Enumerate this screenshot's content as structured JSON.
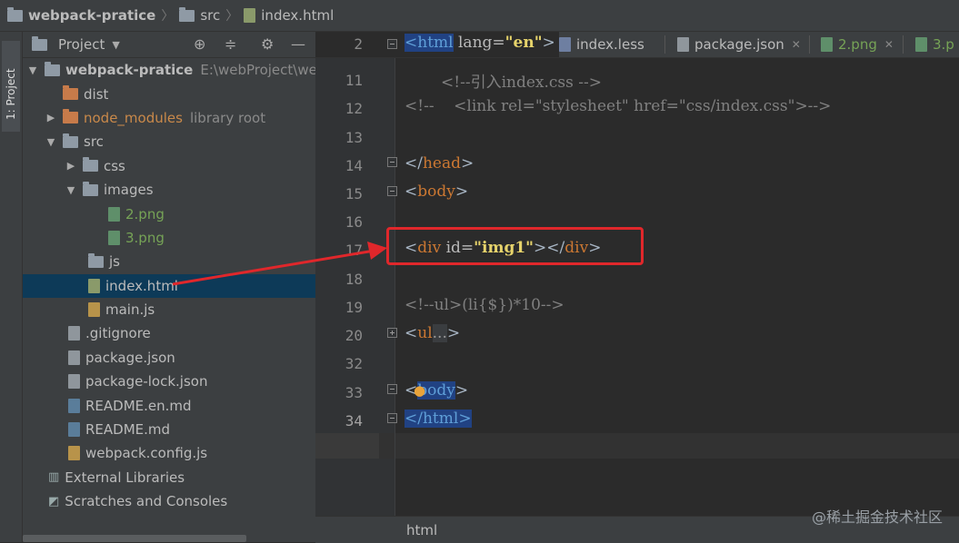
{
  "breadcrumb": {
    "project": "webpack-pratice",
    "folder": "src",
    "file": "index.html"
  },
  "left_strip": {
    "tab_label": "1: Project"
  },
  "project_panel": {
    "title": "Project",
    "tree": [
      {
        "label": "webpack-pratice",
        "extra": "E:\\webProject\\web"
      },
      {
        "label": "dist"
      },
      {
        "label": "node_modules",
        "extra": "library root"
      },
      {
        "label": "src"
      },
      {
        "label": "css"
      },
      {
        "label": "images"
      },
      {
        "label": "2.png"
      },
      {
        "label": "3.png"
      },
      {
        "label": "js"
      },
      {
        "label": "index.html"
      },
      {
        "label": "main.js"
      },
      {
        "label": ".gitignore"
      },
      {
        "label": "package.json"
      },
      {
        "label": "package-lock.json"
      },
      {
        "label": "README.en.md"
      },
      {
        "label": "README.md"
      },
      {
        "label": "webpack.config.js"
      },
      {
        "label": "External Libraries"
      },
      {
        "label": "Scratches and Consoles"
      }
    ]
  },
  "tabs": [
    {
      "label": "index.less"
    },
    {
      "label": "package.json"
    },
    {
      "label": "2.png"
    },
    {
      "label": "3.p"
    }
  ],
  "editor": {
    "line_numbers": [
      "2",
      "11",
      "12",
      "13",
      "14",
      "15",
      "16",
      "17",
      "18",
      "19",
      "20",
      "32",
      "33",
      "34"
    ],
    "code": {
      "l2_open": "<",
      "l2_tag": "html",
      "l2_attr": " lang=",
      "l2_val": "\"en\"",
      "l2_close": ">",
      "l11": "<!--引入index.css -->",
      "l12": "<!--    <link rel=\"stylesheet\" href=\"css/index.css\">-->",
      "l14_a": "</",
      "l14_tag": "head",
      "l14_b": ">",
      "l15_a": "<",
      "l15_tag": "body",
      "l15_b": ">",
      "l17_a": "<",
      "l17_tag": "div",
      "l17_attr": " id=",
      "l17_val": "\"img1\"",
      "l17_b": "></",
      "l17_tag2": "div",
      "l17_c": ">",
      "l19": "<!--ul>(li{$})*10-->",
      "l20_a": "<",
      "l20_tag": "ul",
      "l20_fold": "...",
      "l20_b": ">",
      "l33_a": "<",
      "l33_tag": "body",
      "l33_b": ">",
      "l34_a": "</",
      "l34_tag": "html",
      "l34_b": ">"
    }
  },
  "status_bar": {
    "breadcrumb": "html"
  },
  "watermark": "@稀土掘金技术社区",
  "colors": {
    "annotation_red": "#e0272b",
    "selection": "#0d3a58"
  }
}
